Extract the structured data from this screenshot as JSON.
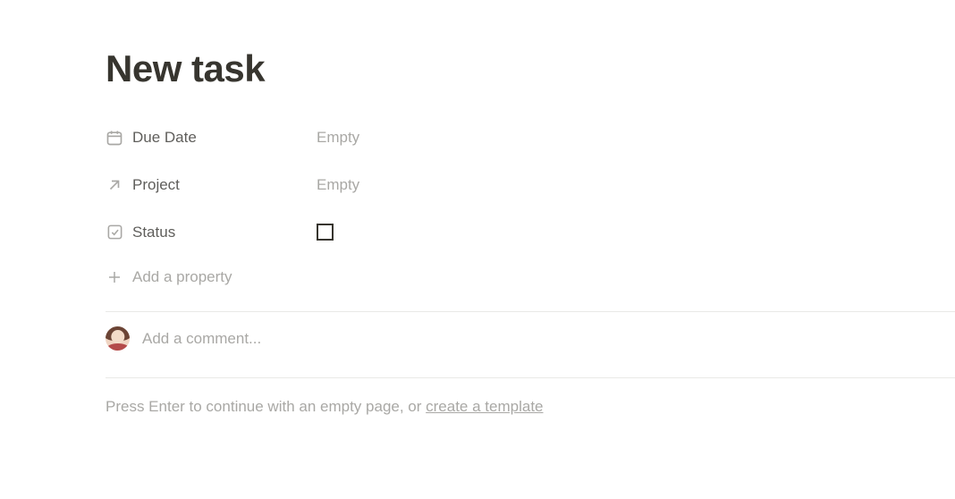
{
  "title": "New task",
  "properties": {
    "due_date": {
      "label": "Due Date",
      "value": "Empty"
    },
    "project": {
      "label": "Project",
      "value": "Empty"
    },
    "status": {
      "label": "Status",
      "checked": false
    }
  },
  "add_property_label": "Add a property",
  "comment_placeholder": "Add a comment...",
  "body_hint": {
    "prefix": "Press Enter to continue with an empty page, or ",
    "link": "create a template"
  }
}
